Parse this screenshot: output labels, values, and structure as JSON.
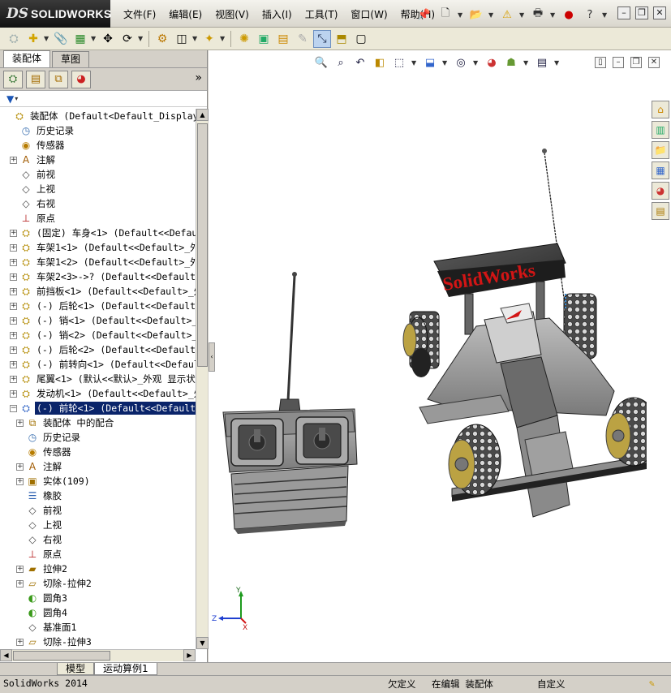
{
  "app": {
    "logo_prefix": "DS",
    "logo_text": "SOLIDWORKS"
  },
  "menus": [
    "文件(F)",
    "编辑(E)",
    "视图(V)",
    "插入(I)",
    "工具(T)",
    "窗口(W)",
    "帮助(H)"
  ],
  "panel_tabs": [
    "装配体",
    "草图"
  ],
  "feature_tree": [
    {
      "label": "装配体  (Default<Default_Display State",
      "expander": "",
      "icon": "assembly-icon",
      "indent": 0
    },
    {
      "label": "历史记录",
      "expander": "",
      "icon": "history-icon",
      "indent": 1
    },
    {
      "label": "传感器",
      "expander": "",
      "icon": "sensor-icon",
      "indent": 1
    },
    {
      "label": "注解",
      "expander": "+",
      "icon": "annotation-icon",
      "indent": 1
    },
    {
      "label": "前视",
      "expander": "",
      "icon": "plane-icon",
      "indent": 1
    },
    {
      "label": "上视",
      "expander": "",
      "icon": "plane-icon",
      "indent": 1
    },
    {
      "label": "右视",
      "expander": "",
      "icon": "plane-icon",
      "indent": 1
    },
    {
      "label": "原点",
      "expander": "",
      "icon": "origin-icon",
      "indent": 1
    },
    {
      "label": "(固定) 车身<1> (Default<<Default>",
      "expander": "+",
      "icon": "part-icon",
      "indent": 1
    },
    {
      "label": "车架1<1> (Default<<Default>_外观",
      "expander": "+",
      "icon": "part-icon",
      "indent": 1
    },
    {
      "label": "车架1<2> (Default<<Default>_外观",
      "expander": "+",
      "icon": "part-icon",
      "indent": 1
    },
    {
      "label": "车架2<3>->? (Default<<Default>_外",
      "expander": "+",
      "icon": "part-icon",
      "indent": 1
    },
    {
      "label": "前挡板<1> (Default<<Default>_外观",
      "expander": "+",
      "icon": "part-icon",
      "indent": 1
    },
    {
      "label": "(-) 后轮<1> (Default<<Default>_外",
      "expander": "+",
      "icon": "part-icon",
      "indent": 1
    },
    {
      "label": "(-) 销<1> (Default<<Default>_外观",
      "expander": "+",
      "icon": "part-icon",
      "indent": 1
    },
    {
      "label": "(-) 销<2> (Default<<Default>_外观",
      "expander": "+",
      "icon": "part-icon",
      "indent": 1
    },
    {
      "label": "(-) 后轮<2> (Default<<Default>_外",
      "expander": "+",
      "icon": "part-icon",
      "indent": 1
    },
    {
      "label": "(-) 前转向<1> (Default<<Default>_",
      "expander": "+",
      "icon": "part-icon",
      "indent": 1
    },
    {
      "label": "尾翼<1> (默认<<默认>_外观 显示状",
      "expander": "+",
      "icon": "part-icon",
      "indent": 1
    },
    {
      "label": "发动机<1> (Default<<Default>_外观",
      "expander": "+",
      "icon": "part-icon",
      "indent": 1
    },
    {
      "label": "(-) 前轮<1> (Default<<Default> 外",
      "expander": "−",
      "icon": "part-selected-icon",
      "indent": 1,
      "selected": true
    },
    {
      "label": "装配体 中的配合",
      "expander": "+",
      "icon": "mate-icon",
      "indent": 2
    },
    {
      "label": "历史记录",
      "expander": "",
      "icon": "history-icon",
      "indent": 2
    },
    {
      "label": "传感器",
      "expander": "",
      "icon": "sensor-icon",
      "indent": 2
    },
    {
      "label": "注解",
      "expander": "+",
      "icon": "annotation-icon",
      "indent": 2
    },
    {
      "label": "实体(109)",
      "expander": "+",
      "icon": "solid-body-icon",
      "indent": 2
    },
    {
      "label": "橡胶",
      "expander": "",
      "icon": "material-icon",
      "indent": 2
    },
    {
      "label": "前视",
      "expander": "",
      "icon": "plane-icon",
      "indent": 2
    },
    {
      "label": "上视",
      "expander": "",
      "icon": "plane-icon",
      "indent": 2
    },
    {
      "label": "右视",
      "expander": "",
      "icon": "plane-icon",
      "indent": 2
    },
    {
      "label": "原点",
      "expander": "",
      "icon": "origin-icon",
      "indent": 2
    },
    {
      "label": "拉伸2",
      "expander": "+",
      "icon": "extrude-icon",
      "indent": 2
    },
    {
      "label": "切除-拉伸2",
      "expander": "+",
      "icon": "cut-extrude-icon",
      "indent": 2
    },
    {
      "label": "圆角3",
      "expander": "",
      "icon": "fillet-icon",
      "indent": 2
    },
    {
      "label": "圆角4",
      "expander": "",
      "icon": "fillet-icon",
      "indent": 2
    },
    {
      "label": "基准面1",
      "expander": "",
      "icon": "plane-icon",
      "indent": 2
    },
    {
      "label": "切除-拉伸3",
      "expander": "+",
      "icon": "cut-extrude-icon",
      "indent": 2
    }
  ],
  "bottom_tabs": [
    "模型",
    "运动算例1"
  ],
  "status": {
    "version": "SolidWorks 2014",
    "under_defined": "欠定义",
    "editing": "在编辑 装配体",
    "custom": "自定义"
  },
  "model": {
    "wing_text": "SolidWorks",
    "axes": {
      "x": "X",
      "y": "Y",
      "z": "Z"
    }
  },
  "colors": {
    "selection": "#0a246a",
    "wing_text": "#d21515",
    "car_body": "#8e8e8e"
  }
}
